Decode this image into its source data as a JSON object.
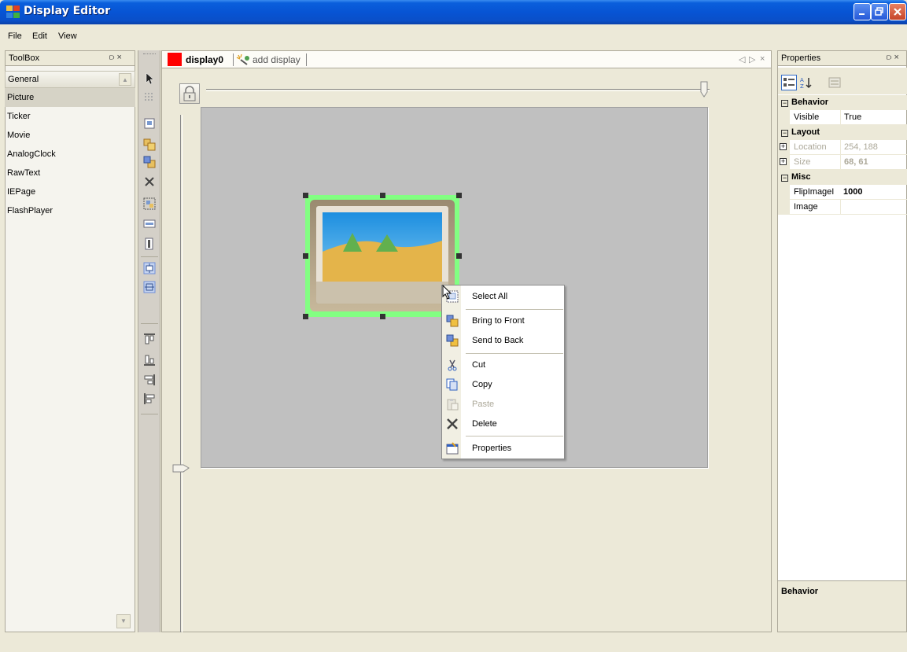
{
  "window": {
    "title": "Display Editor"
  },
  "menu": {
    "items": [
      "File",
      "Edit",
      "View"
    ]
  },
  "toolbox": {
    "title": "ToolBox",
    "pin_close": "⫐ ×",
    "items": [
      "General",
      "Picture",
      "Ticker",
      "Movie",
      "AnalogClock",
      "RawText",
      "IEPage",
      "FlashPlayer"
    ],
    "selected": "Picture"
  },
  "document": {
    "tabs": {
      "active": "display0",
      "add": "add display"
    },
    "tab_color": "#ff0000",
    "nav": [
      "◁",
      "▷",
      "×"
    ]
  },
  "canvas": {
    "selection_color": "#82ff82",
    "background": "#c0c0c0"
  },
  "context_menu": {
    "items": [
      {
        "label": "Select All",
        "icon": "select-all-icon",
        "enabled": true
      },
      {
        "label": "Bring to Front",
        "icon": "bring-to-front-icon",
        "enabled": true
      },
      {
        "label": "Send to Back",
        "icon": "send-to-back-icon",
        "enabled": true
      },
      {
        "label": "Cut",
        "icon": "cut-icon",
        "enabled": true
      },
      {
        "label": "Copy",
        "icon": "copy-icon",
        "enabled": true
      },
      {
        "label": "Paste",
        "icon": "paste-icon",
        "enabled": false
      },
      {
        "label": "Delete",
        "icon": "delete-icon",
        "enabled": true
      },
      {
        "label": "Properties",
        "icon": "properties-icon",
        "enabled": true
      }
    ]
  },
  "properties": {
    "title": "Properties",
    "pin_close": "⫐ ×",
    "categories": {
      "behavior": "Behavior",
      "layout": "Layout",
      "misc": "Misc"
    },
    "rows": {
      "visible": {
        "name": "Visible",
        "value": "True"
      },
      "location": {
        "name": "Location",
        "value": "254, 188"
      },
      "size": {
        "name": "Size",
        "value": "68, 61"
      },
      "flipimage": {
        "name": "FlipImageI",
        "value": "1000"
      },
      "image": {
        "name": "Image",
        "value": ""
      }
    },
    "description_title": "Behavior"
  }
}
